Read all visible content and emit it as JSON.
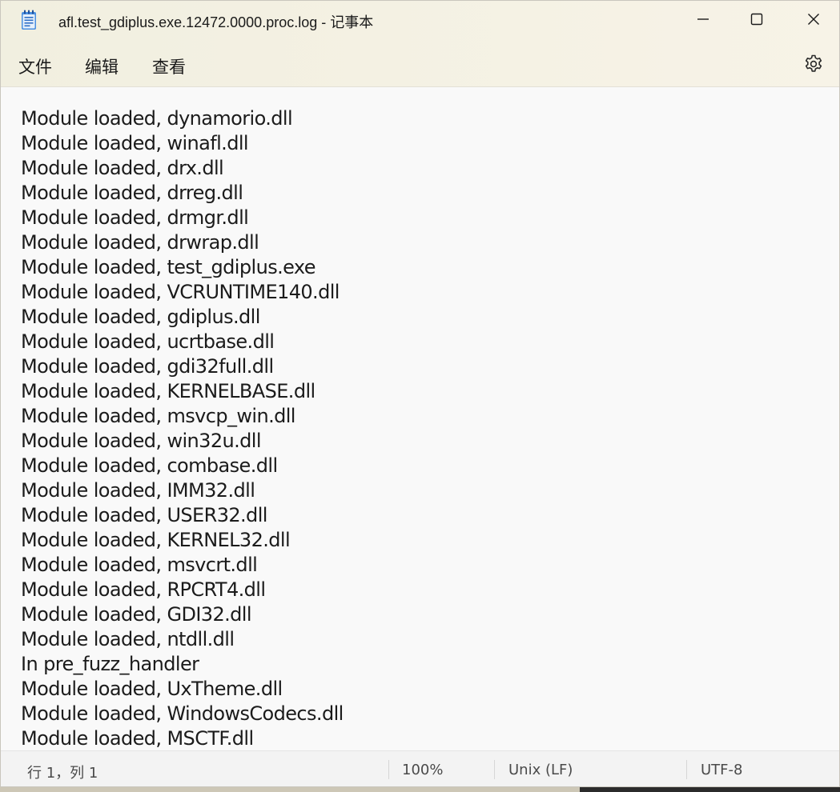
{
  "window": {
    "title": "afl.test_gdiplus.exe.12472.0000.proc.log - 记事本",
    "app_icon": "notepad-icon"
  },
  "controls": {
    "minimize_icon": "minimize-icon",
    "maximize_icon": "maximize-icon",
    "close_icon": "close-icon"
  },
  "menu": {
    "file": "文件",
    "edit": "编辑",
    "view": "查看",
    "settings_icon": "gear-icon"
  },
  "editor": {
    "lines": [
      "Module loaded, dynamorio.dll",
      "Module loaded, winafl.dll",
      "Module loaded, drx.dll",
      "Module loaded, drreg.dll",
      "Module loaded, drmgr.dll",
      "Module loaded, drwrap.dll",
      "Module loaded, test_gdiplus.exe",
      "Module loaded, VCRUNTIME140.dll",
      "Module loaded, gdiplus.dll",
      "Module loaded, ucrtbase.dll",
      "Module loaded, gdi32full.dll",
      "Module loaded, KERNELBASE.dll",
      "Module loaded, msvcp_win.dll",
      "Module loaded, win32u.dll",
      "Module loaded, combase.dll",
      "Module loaded, IMM32.dll",
      "Module loaded, USER32.dll",
      "Module loaded, KERNEL32.dll",
      "Module loaded, msvcrt.dll",
      "Module loaded, RPCRT4.dll",
      "Module loaded, GDI32.dll",
      "Module loaded, ntdll.dll",
      "In pre_fuzz_handler",
      "Module loaded, UxTheme.dll",
      "Module loaded, WindowsCodecs.dll",
      "Module loaded, MSCTF.dll"
    ]
  },
  "status": {
    "position": "行 1，列 1",
    "zoom": "100%",
    "line_ending": "Unix (LF)",
    "encoding": "UTF-8"
  },
  "colors": {
    "chrome_bg": "#f3f1e3",
    "editor_bg": "#f9f9f9",
    "statusbar_bg": "#f3f3f3",
    "icon_blue": "#2f6fc7"
  }
}
